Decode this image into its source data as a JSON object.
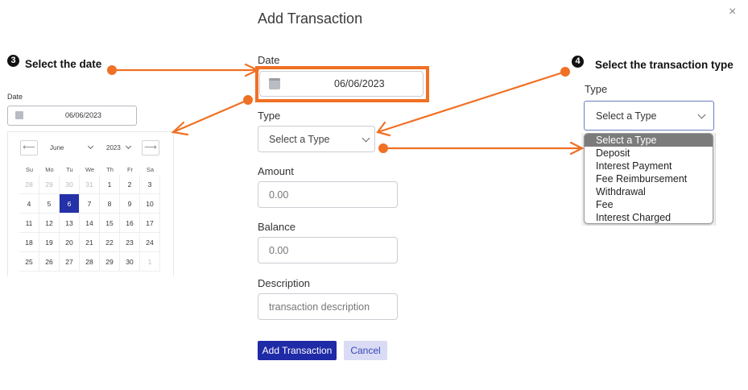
{
  "modal": {
    "title": "Add Transaction",
    "close_glyph": "×",
    "date_label": "Date",
    "date_value": "06/06/2023",
    "type_label": "Type",
    "type_value": "Select a Type",
    "amount_label": "Amount",
    "amount_placeholder": "0.00",
    "balance_label": "Balance",
    "balance_placeholder": "0.00",
    "description_label": "Description",
    "description_placeholder": "transaction description",
    "submit_label": "Add Transaction",
    "cancel_label": "Cancel"
  },
  "steps": {
    "date": {
      "number": "3",
      "text": "Select the date"
    },
    "type": {
      "number": "4",
      "text": "Select the transaction type"
    }
  },
  "left_panel": {
    "label": "Date",
    "value": "06/06/2023",
    "prev_glyph": "⟵",
    "next_glyph": "⟶",
    "month": "June",
    "year": "2023",
    "weekdays": [
      "Su",
      "Mo",
      "Tu",
      "We",
      "Th",
      "Fr",
      "Sa"
    ],
    "weeks": [
      [
        "28",
        "29",
        "30",
        "31",
        "1",
        "2",
        "3"
      ],
      [
        "4",
        "5",
        "6",
        "7",
        "8",
        "9",
        "10"
      ],
      [
        "11",
        "12",
        "13",
        "14",
        "15",
        "16",
        "17"
      ],
      [
        "18",
        "19",
        "20",
        "21",
        "22",
        "23",
        "24"
      ],
      [
        "25",
        "26",
        "27",
        "28",
        "29",
        "30",
        "1"
      ]
    ],
    "selected_day": "6"
  },
  "right_panel": {
    "label": "Type",
    "value": "Select a Type",
    "options": [
      "Select a Type",
      "Deposit",
      "Interest Payment",
      "Fee Reimbursement",
      "Withdrawal",
      "Fee",
      "Interest Charged"
    ],
    "active_option": "Select a Type"
  },
  "colors": {
    "accent_orange": "#f07024",
    "primary_button": "#1f2aa6",
    "secondary_button": "#d9dcf4",
    "selected_day": "#2431a8"
  }
}
